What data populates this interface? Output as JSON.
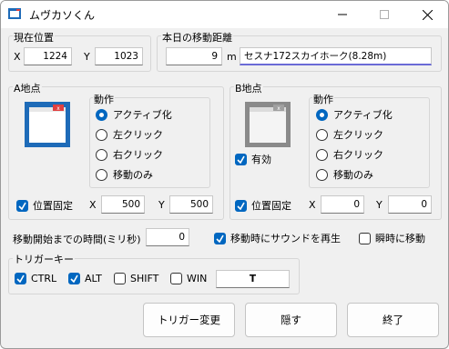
{
  "window": {
    "title": "ムヴカソくん",
    "controls": {
      "minimize": "—",
      "maximize": "☐",
      "close": "✕"
    }
  },
  "current_position": {
    "label": "現在位置",
    "x_label": "X",
    "x_value": "1224",
    "y_label": "Y",
    "y_value": "1023"
  },
  "distance": {
    "label": "本日の移動距離",
    "value": "9",
    "unit": "m",
    "aircraft": "セスナ172スカイホーク(8.28m)"
  },
  "point_a": {
    "label": "A地点",
    "action_label": "動作",
    "options": [
      "アクティブ化",
      "左クリック",
      "右クリック",
      "移動のみ"
    ],
    "selected": 0,
    "fixed_label": "位置固定",
    "fixed": true,
    "x_label": "X",
    "x_value": "500",
    "y_label": "Y",
    "y_value": "500"
  },
  "point_b": {
    "label": "B地点",
    "action_label": "動作",
    "options": [
      "アクティブ化",
      "左クリック",
      "右クリック",
      "移動のみ"
    ],
    "selected": 0,
    "enabled_label": "有効",
    "enabled": true,
    "fixed_label": "位置固定",
    "fixed": true,
    "x_label": "X",
    "x_value": "0",
    "y_label": "Y",
    "y_value": "0"
  },
  "timing": {
    "label": "移動開始までの時間(ミリ秒)",
    "value": "0"
  },
  "sound": {
    "label": "移動時にサウンドを再生",
    "checked": true
  },
  "instant": {
    "label": "瞬時に移動",
    "checked": false
  },
  "trigger": {
    "label": "トリガーキー",
    "ctrl": {
      "label": "CTRL",
      "checked": true
    },
    "alt": {
      "label": "ALT",
      "checked": true
    },
    "shift": {
      "label": "SHIFT",
      "checked": false
    },
    "win": {
      "label": "WIN",
      "checked": false
    },
    "key": "T"
  },
  "buttons": {
    "change_trigger": "トリガー変更",
    "hide": "隠す",
    "exit": "終了"
  },
  "colors": {
    "accent": "#0067c0",
    "window_bg": "#f0f0f0",
    "underline": "#6b6bd6"
  }
}
